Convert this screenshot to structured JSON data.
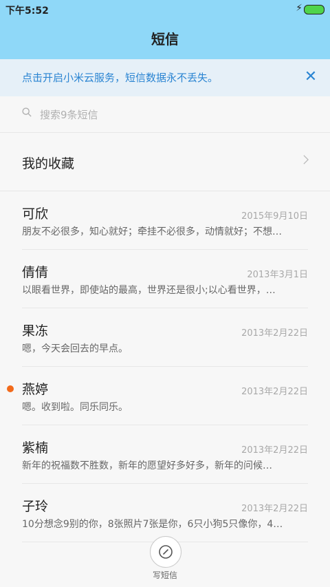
{
  "status": {
    "time": "下午5:52"
  },
  "title": "短信",
  "banner": {
    "text": "点击开启小米云服务，短信数据永不丢失。"
  },
  "search": {
    "placeholder": "搜索9条短信"
  },
  "favorites": {
    "label": "我的收藏"
  },
  "messages": [
    {
      "name": "可欣",
      "date": "2015年9月10日",
      "preview": "朋友不必很多，知心就好；牵挂不必很多，动情就好；不想…",
      "unread": false
    },
    {
      "name": "倩倩",
      "date": "2013年3月1日",
      "preview": "以眼看世界，即使站的最高，世界还是很小;以心看世界，…",
      "unread": false
    },
    {
      "name": "果冻",
      "date": "2013年2月22日",
      "preview": "嗯，今天会回去的早点。",
      "unread": false
    },
    {
      "name": "燕婷",
      "date": "2013年2月22日",
      "preview": "嗯。收到啦。同乐同乐。",
      "unread": true
    },
    {
      "name": "紫楠",
      "date": "2013年2月22日",
      "preview": "新年的祝福数不胜数，新年的愿望好多好多，新年的问候…",
      "unread": false
    },
    {
      "name": "子玲",
      "date": "2013年2月22日",
      "preview": "10分想念9别的你，8张照片7张是你，6只小狗5只像你，4…",
      "unread": false
    }
  ],
  "compose": {
    "label": "写短信"
  }
}
